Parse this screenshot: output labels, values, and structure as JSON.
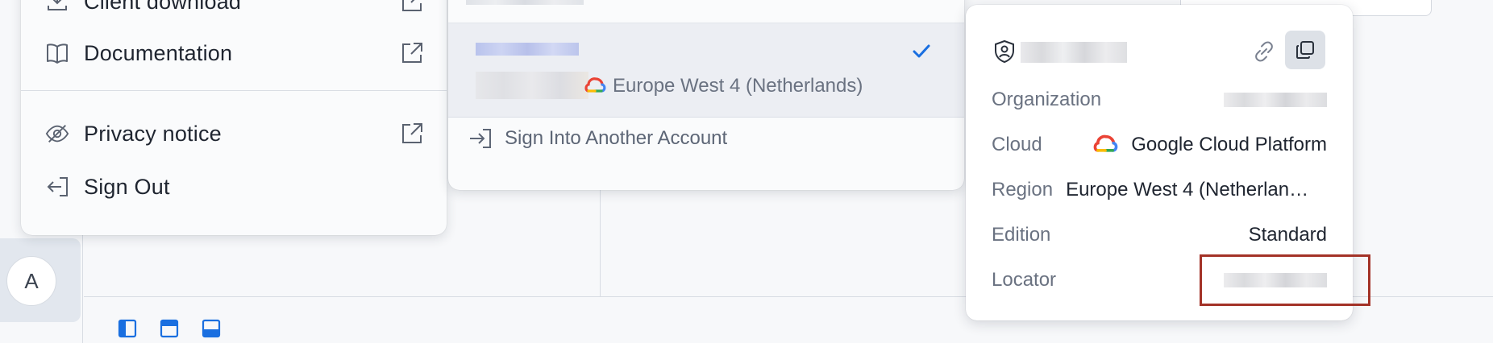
{
  "user_menu": {
    "items": [
      {
        "label": "Client download",
        "icon": "download-icon",
        "external": true
      },
      {
        "label": "Documentation",
        "icon": "book-icon",
        "external": true
      },
      {
        "label": "Privacy notice",
        "icon": "eye-slash-icon",
        "external": true
      },
      {
        "label": "Sign Out",
        "icon": "sign-out-icon",
        "external": false
      }
    ]
  },
  "accounts": {
    "selected": {
      "region": "Europe West 4 (Netherlands)",
      "cloud_icon": "google-cloud-icon",
      "checked": true
    },
    "sign_in_label": "Sign Into Another Account"
  },
  "details": {
    "rows": [
      {
        "key": "Organization",
        "value": ""
      },
      {
        "key": "Cloud",
        "value": "Google Cloud Platform"
      },
      {
        "key": "Region",
        "value": "Europe West 4 (Netherlan…"
      },
      {
        "key": "Edition",
        "value": "Standard"
      },
      {
        "key": "Locator",
        "value": ""
      }
    ]
  },
  "sidebar": {
    "avatar_initial": "A"
  },
  "colors": {
    "accent": "#1a6fe0",
    "highlight": "#a33227",
    "gcp_blue": "#4285f4",
    "gcp_red": "#ea4335",
    "gcp_yellow": "#fbbc04",
    "gcp_green": "#34a853"
  }
}
